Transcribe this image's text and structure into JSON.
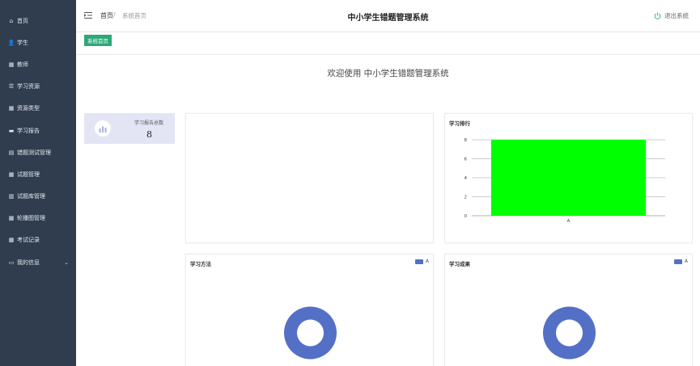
{
  "sidebar": {
    "items": [
      {
        "label": "首页",
        "icon": "home-icon"
      },
      {
        "label": "学生",
        "icon": "user-icon"
      },
      {
        "label": "教师",
        "icon": "grid-icon"
      },
      {
        "label": "学习资源",
        "icon": "sliders-icon"
      },
      {
        "label": "资源类型",
        "icon": "grid-icon"
      },
      {
        "label": "学习报告",
        "icon": "card-icon"
      },
      {
        "label": "错题测试管理",
        "icon": "doc-icon"
      },
      {
        "label": "试题管理",
        "icon": "grid-icon"
      },
      {
        "label": "试题库管理",
        "icon": "bar-chart-icon"
      },
      {
        "label": "轮播图管理",
        "icon": "grid-icon"
      },
      {
        "label": "考试记录",
        "icon": "grid-icon"
      },
      {
        "label": "我的信息",
        "icon": "window-icon",
        "expandable": true
      }
    ]
  },
  "header": {
    "breadcrumb_home": "首页",
    "breadcrumb_separator": "/",
    "breadcrumb_current": "系统首页",
    "title": "中小学生错题管理系统",
    "logout_label": "退出系统"
  },
  "tabs": [
    {
      "label": "系统首页",
      "active": true
    }
  ],
  "welcome": "欢迎使用 中小学生错题管理系统",
  "stat_card": {
    "label": "学习报告总数",
    "value": "8"
  },
  "panels": {
    "ranking": {
      "title": "学习排行"
    },
    "method": {
      "title": "学习方法",
      "legend": "A"
    },
    "results": {
      "title": "学习成果",
      "legend": "A"
    }
  },
  "colors": {
    "sidebar_bg": "#2f3d4f",
    "accent_tab": "#2ca879",
    "bar": "#00ff00",
    "donut": "#5470c6",
    "stat_card_bg": "#e3e5f4",
    "stat_icon": "#aab1df"
  },
  "chart_data": [
    {
      "type": "bar",
      "title": "学习排行",
      "categories": [
        "A"
      ],
      "values": [
        8
      ],
      "ylim": [
        0,
        8
      ],
      "yticks": [
        0,
        2,
        4,
        6,
        8
      ],
      "grid": true
    },
    {
      "type": "pie",
      "title": "学习方法",
      "labels": [
        "A"
      ],
      "values": [
        1
      ],
      "legend": "top-right"
    },
    {
      "type": "pie",
      "title": "学习成果",
      "labels": [
        "A"
      ],
      "values": [
        1
      ],
      "legend": "top-right"
    }
  ]
}
